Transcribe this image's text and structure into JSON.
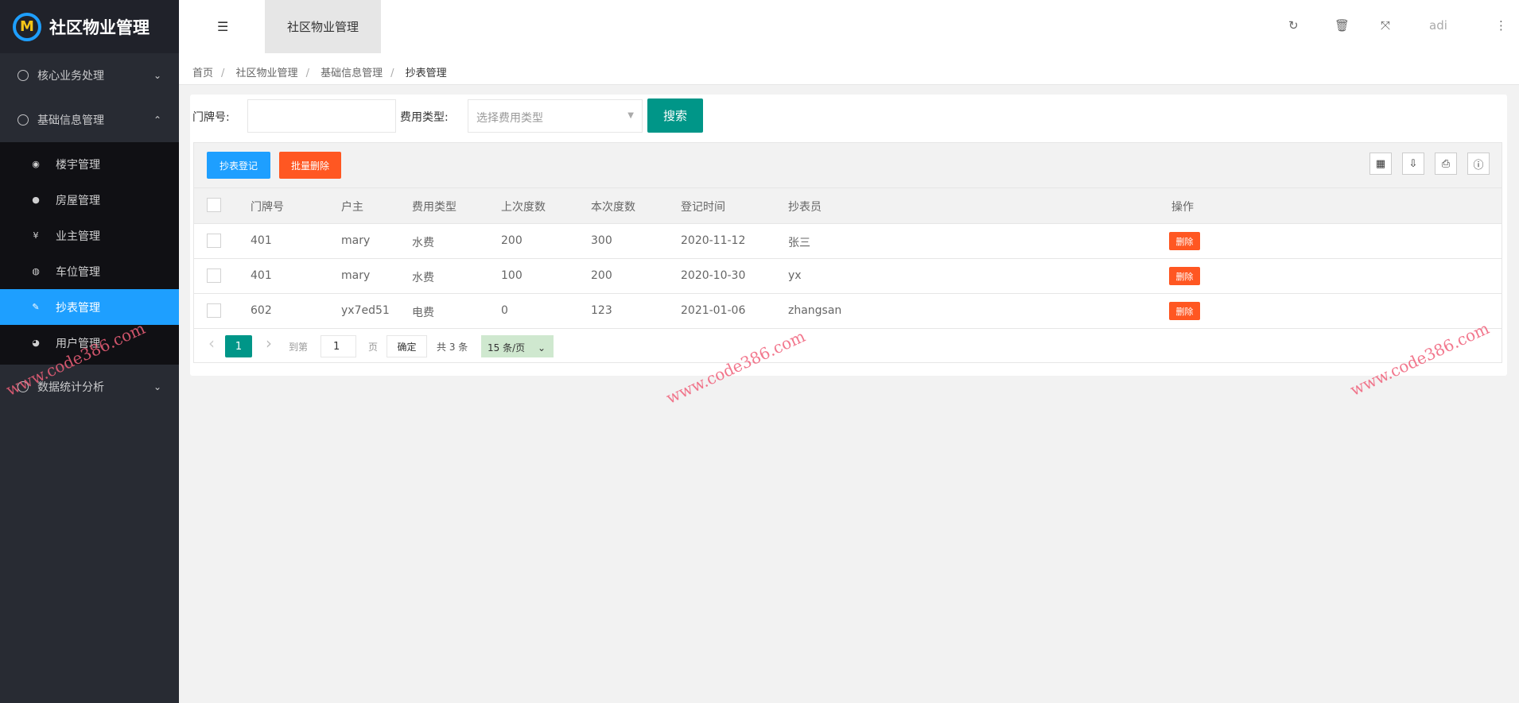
{
  "app": {
    "title": "社区物业管理",
    "logo_letter": "M"
  },
  "sidebar": {
    "groups": [
      {
        "label": "核心业务处理",
        "chevron": "⌄"
      },
      {
        "label": "基础信息管理",
        "chevron": "⌃"
      },
      {
        "label": "数据统计分析",
        "chevron": "⌄"
      }
    ],
    "sub_items": [
      {
        "label": "楼宇管理",
        "icon": "◉"
      },
      {
        "label": "房屋管理",
        "icon": "●"
      },
      {
        "label": "业主管理",
        "icon": "¥"
      },
      {
        "label": "车位管理",
        "icon": "◍"
      },
      {
        "label": "抄表管理",
        "icon": "✎"
      },
      {
        "label": "用户管理",
        "icon": "◕"
      }
    ]
  },
  "header": {
    "tab": "社区物业管理",
    "user": "adi",
    "toggle_icon": "☰",
    "icons": [
      "↻",
      "🗑",
      "⤧",
      "⋮"
    ]
  },
  "breadcrumb": [
    "首页",
    "社区物业管理",
    "基础信息管理",
    "抄表管理"
  ],
  "search": {
    "door_label": "门牌号:",
    "door_value": "",
    "fee_label": "费用类型:",
    "fee_placeholder": "选择费用类型",
    "button": "搜索"
  },
  "toolbar": {
    "add": "抄表登记",
    "batch_delete": "批量删除",
    "icons": [
      "▦",
      "⇩",
      "⎙",
      "ⓘ"
    ]
  },
  "table": {
    "columns": [
      "门牌号",
      "户主",
      "费用类型",
      "上次度数",
      "本次度数",
      "登记时间",
      "抄表员",
      "操作"
    ],
    "rows": [
      {
        "door": "401",
        "owner": "mary",
        "fee": "水费",
        "last": "200",
        "current": "300",
        "date": "2020-11-12",
        "reader": "张三",
        "action": "删除"
      },
      {
        "door": "401",
        "owner": "mary",
        "fee": "水费",
        "last": "100",
        "current": "200",
        "date": "2020-10-30",
        "reader": "yx",
        "action": "删除"
      },
      {
        "door": "602",
        "owner": "yx7ed51",
        "fee": "电费",
        "last": "0",
        "current": "123",
        "date": "2021-01-06",
        "reader": "zhangsan",
        "action": "删除"
      }
    ]
  },
  "pager": {
    "prev": "‹",
    "page": "1",
    "next": "›",
    "goto": "到第",
    "goto_value": "1",
    "page_unit": "页",
    "confirm": "确定",
    "total": "共 3 条",
    "per_page": "15 条/页"
  },
  "watermark": "www.code386.com"
}
